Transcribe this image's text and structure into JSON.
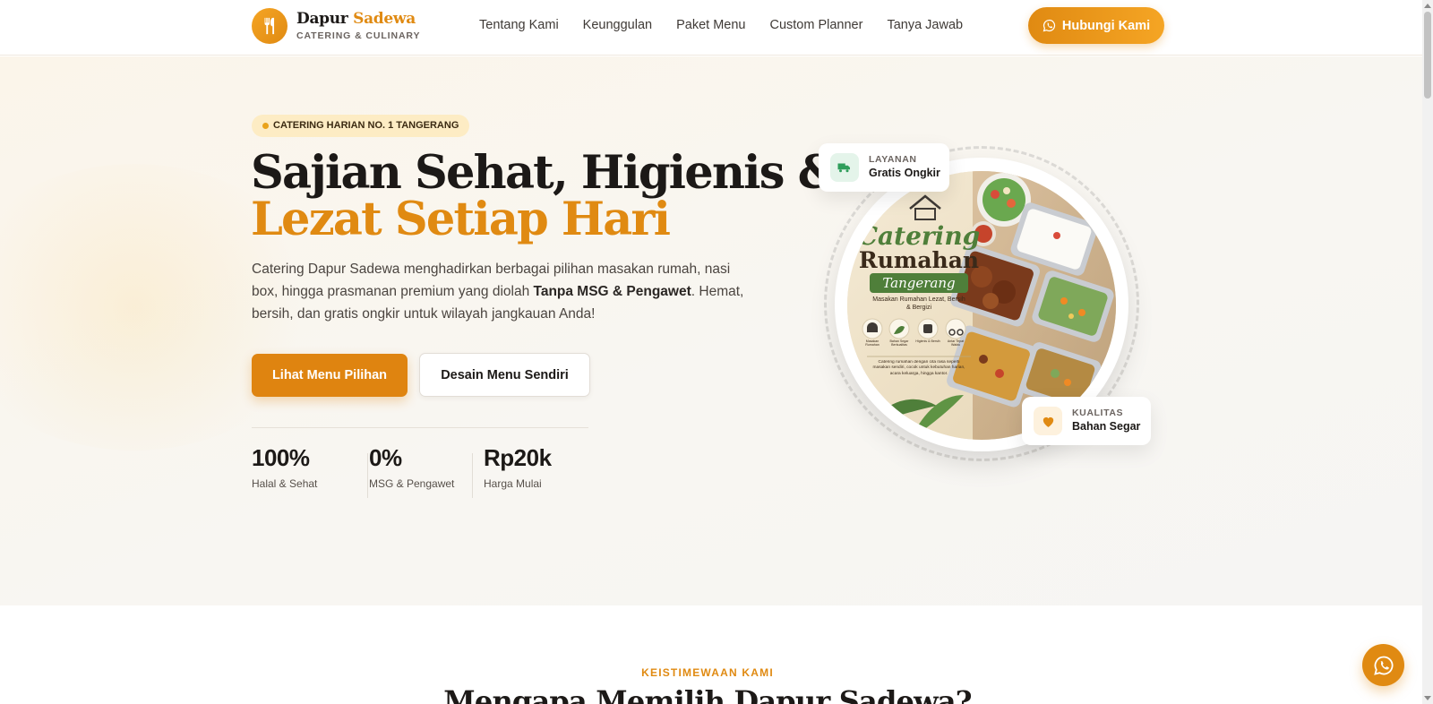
{
  "brand": {
    "name_part1": "Dapur",
    "name_part2": "Sadewa",
    "tagline": "CATERING & CULINARY",
    "logo_icon": "fork-knife-icon",
    "accent_color": "#e08a12"
  },
  "nav": {
    "items": [
      {
        "label": "Tentang Kami"
      },
      {
        "label": "Keunggulan"
      },
      {
        "label": "Paket Menu"
      },
      {
        "label": "Custom Planner"
      },
      {
        "label": "Tanya Jawab"
      }
    ],
    "cta_label": "Hubungi Kami",
    "cta_icon": "whatsapp-icon"
  },
  "hero": {
    "badge": "CATERING HARIAN NO. 1 TANGERANG",
    "title_line1": "Sajian Sehat, Higienis &",
    "title_line2": "Lezat Setiap Hari",
    "lead_before": "Catering Dapur Sadewa menghadirkan berbagai pilihan masakan rumah, nasi box, hingga prasmanan premium yang diolah ",
    "lead_bold": "Tanpa MSG & Pengawet",
    "lead_after": ". Hemat, bersih, dan gratis ongkir untuk wilayah jangkauan Anda!",
    "primary_button": "Lihat Menu Pilihan",
    "secondary_button": "Desain Menu Sendiri",
    "stats": [
      {
        "value": "100%",
        "label": "Halal & Sehat"
      },
      {
        "value": "0%",
        "label": "MSG & Pengawet"
      },
      {
        "value": "Rp20k",
        "label": "Harga Mulai"
      }
    ]
  },
  "hero_image": {
    "title_word1": "Catering",
    "title_word2": "Rumahan",
    "title_word3": "Tangerang",
    "subtitle": "Masakan Rumahan Lezat, Bersih & Bergizi",
    "feature_icons": [
      {
        "label": "Masakan Rumahan"
      },
      {
        "label": "Bahan Segar Berkualitas"
      },
      {
        "label": "Higienis & Bersih"
      },
      {
        "label": "Antar Tepat Waktu"
      }
    ],
    "description": "Catering rumahan dengan cita rasa seperti masakan sendiri, cocok untuk kebutuhan harian, acara keluarga, hingga kantor."
  },
  "floating_cards": {
    "delivery": {
      "small": "LAYANAN",
      "big": "Gratis Ongkir",
      "icon": "truck-icon"
    },
    "quality": {
      "small": "KUALITAS",
      "big": "Bahan Segar",
      "icon": "heart-icon"
    }
  },
  "next_section": {
    "kicker": "KEISTIMEWAAN KAMI",
    "title": "Mengapa Memilih Dapur Sadewa?"
  },
  "whatsapp_fab": {
    "icon": "whatsapp-icon"
  }
}
